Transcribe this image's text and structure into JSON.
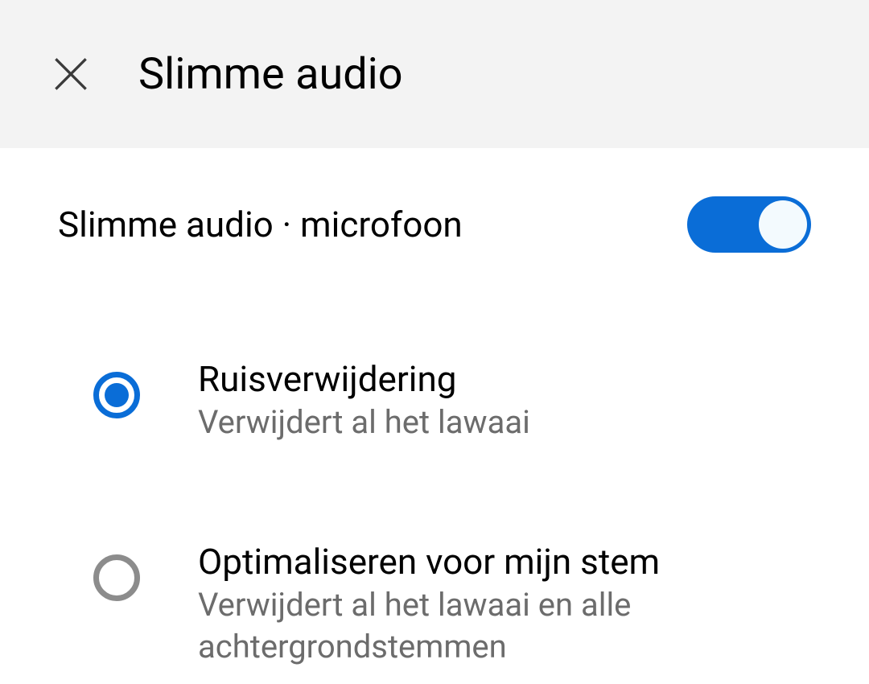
{
  "header": {
    "title": "Slimme audio"
  },
  "toggle": {
    "label": "Slimme audio · microfoon",
    "state": "on"
  },
  "options": [
    {
      "title": "Ruisverwijdering",
      "description": "Verwijdert al het lawaai",
      "selected": true
    },
    {
      "title": "Optimaliseren voor mijn stem",
      "description": "Verwijdert al het lawaai en alle achtergrondstemmen",
      "selected": false
    }
  ],
  "colors": {
    "accent": "#0a6dd7",
    "header_bg": "#f3f3f3",
    "text_primary": "#000000",
    "text_secondary": "#6c6c6c",
    "radio_unselected": "#8c8c8c"
  }
}
